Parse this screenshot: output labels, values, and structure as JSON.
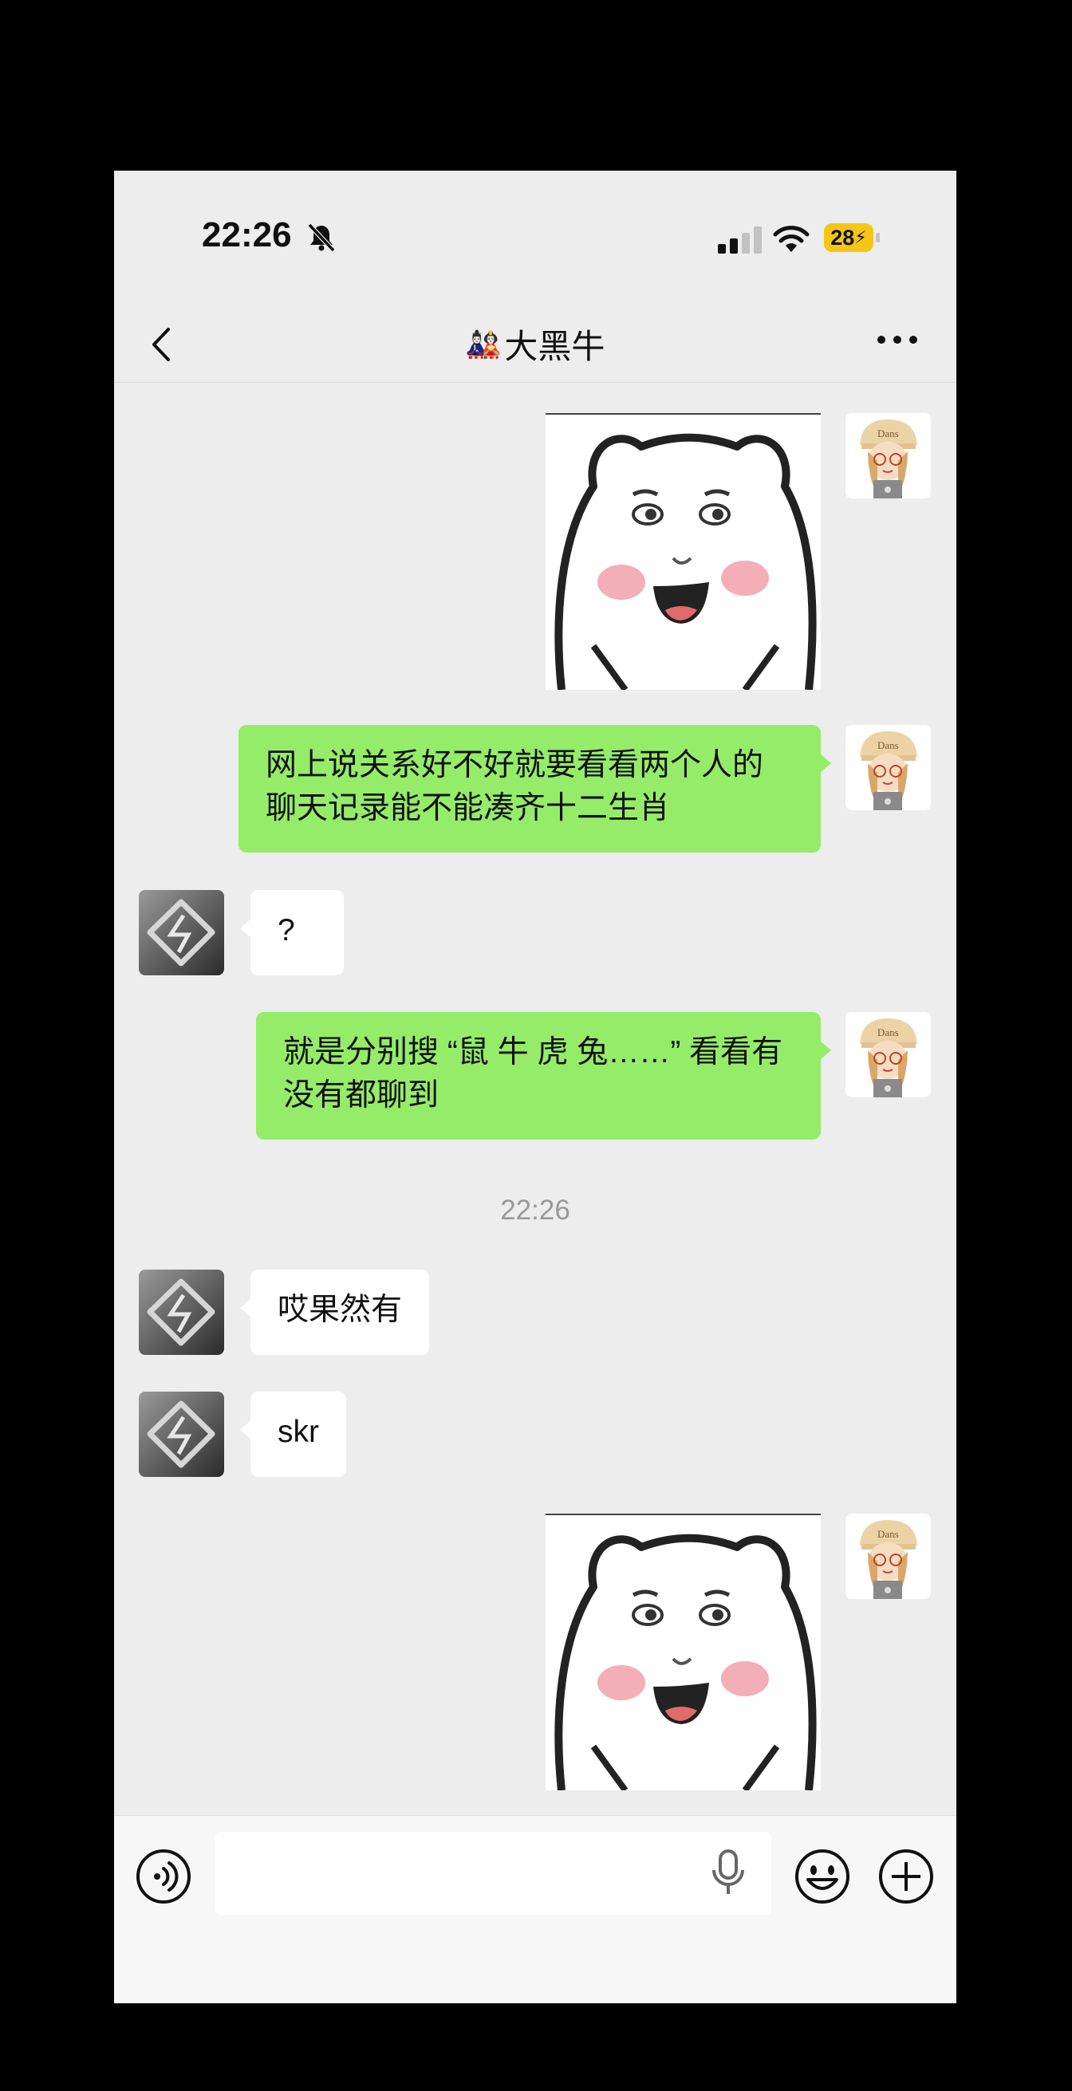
{
  "status_bar": {
    "time": "22:26",
    "battery": "28"
  },
  "nav": {
    "title_emoji": "🎎",
    "title": "大黑牛"
  },
  "messages": [
    {
      "from": "me",
      "type": "sticker"
    },
    {
      "from": "me",
      "type": "text",
      "text": "网上说关系好不好就要看看两个人的聊天记录能不能凑齐十二生肖"
    },
    {
      "from": "other",
      "type": "text",
      "text": "?"
    },
    {
      "from": "me",
      "type": "text",
      "text": "就是分别搜 “鼠 牛 虎 兔……” 看看有没有都聊到"
    },
    {
      "from": "other",
      "type": "text",
      "text": "哎果然有"
    },
    {
      "from": "other",
      "type": "text",
      "text": "skr"
    },
    {
      "from": "me",
      "type": "sticker"
    }
  ],
  "timestamp": "22:26",
  "input": {
    "value": "",
    "placeholder": ""
  },
  "icons": {
    "back": "chevron-left-icon",
    "more": "more-dots-icon",
    "voice": "voice-icon",
    "mic": "microphone-icon",
    "emoji": "emoji-icon",
    "plus": "plus-icon",
    "bell": "bell-muted-icon",
    "signal": "signal-icon",
    "wifi": "wifi-icon"
  },
  "colors": {
    "bubble_me": "#95ec69",
    "bubble_other": "#ffffff",
    "background": "#ededed",
    "battery": "#f5c518"
  }
}
